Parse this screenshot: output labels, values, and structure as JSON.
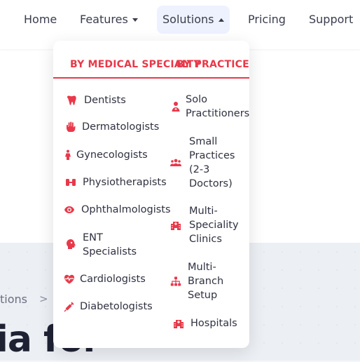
{
  "nav": {
    "home": "Home",
    "features": "Features",
    "solutions": "Solutions",
    "pricing": "Pricing",
    "support": "Support"
  },
  "dropdown": {
    "tab_specialty": "BY MEDICAL SPECIALTY",
    "tab_practice": "BY PRACTICE",
    "specialties": [
      {
        "label": "Dentists",
        "icon": "tooth-icon"
      },
      {
        "label": "Dermatologists",
        "icon": "hand-icon"
      },
      {
        "label": "Gynecologists",
        "icon": "female-icon"
      },
      {
        "label": "Physiotherapists",
        "icon": "dumbbell-icon"
      },
      {
        "label": "Ophthalmologists",
        "icon": "eye-icon"
      },
      {
        "label": "ENT\nSpecialists",
        "icon": "head-side-icon"
      },
      {
        "label": "Cardiologists",
        "icon": "heartbeat-icon"
      },
      {
        "label": "Diabetologists",
        "icon": "syringe-icon"
      }
    ],
    "practices": [
      {
        "label": "Solo\nPractitioners",
        "icon": "doctor-icon"
      },
      {
        "label": "Small\nPractices\n(2-3\nDoctors)",
        "icon": "users-icon"
      },
      {
        "label": "Multi-\nSpeciality\nClinics",
        "icon": "hospital-icon"
      },
      {
        "label": "Multi-\nBranch\nSetup",
        "icon": "sitemap-icon"
      },
      {
        "label": "Hospitals",
        "icon": "hospital-icon"
      }
    ]
  },
  "breadcrumb": {
    "partial": "tions",
    "separator": ">"
  },
  "hero": {
    "heading_partial": "ia for"
  },
  "colors": {
    "accent": "#e8394a",
    "nav_active_bg": "#eef2ff"
  }
}
